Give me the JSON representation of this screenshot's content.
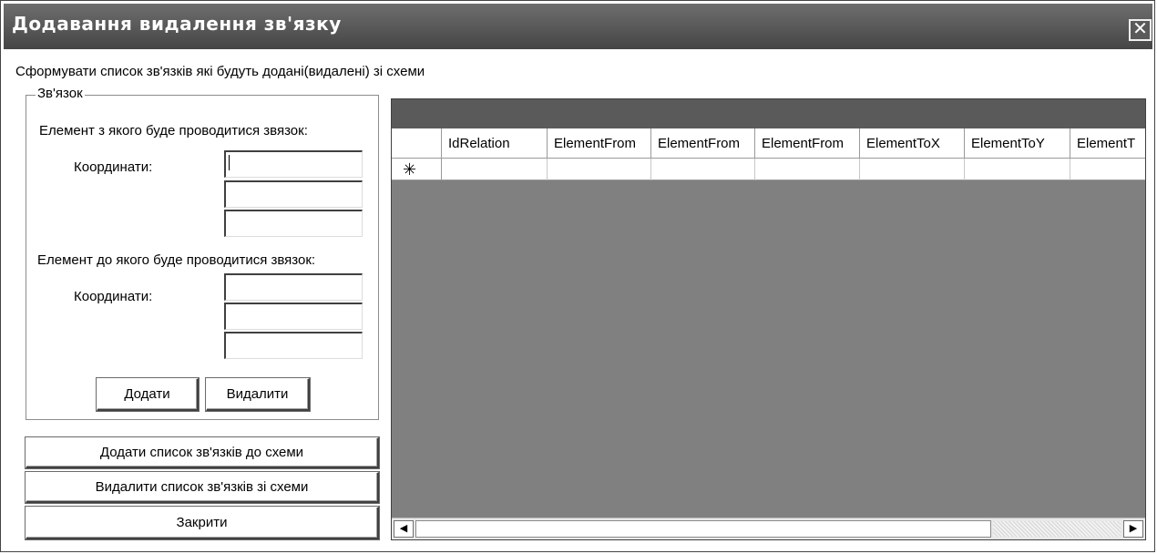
{
  "window": {
    "title": "Додавання видалення зв'язку",
    "close_glyph": "✕"
  },
  "instruction": "Сформувати список зв'язків які будуть додані(видалені) зі схеми",
  "group": {
    "title": "Зв'язок",
    "from_label": "Елемент з якого буде проводитися звязок:",
    "to_label": "Елемент до якого буде проводитися звязок:",
    "coords_label": "Координати:",
    "from_coords": [
      "",
      "",
      ""
    ],
    "to_coords": [
      "",
      "",
      ""
    ],
    "add_button": "Додати",
    "delete_button": "Видалити"
  },
  "actions": {
    "add_list": "Додати список зв'язків до схеми",
    "delete_list": "Видалити список зв'язків зі схеми",
    "close": "Закрити"
  },
  "grid": {
    "columns": [
      "IdRelation",
      "ElementFrom",
      "ElementFrom",
      "ElementFrom",
      "ElementToX",
      "ElementToY",
      "ElementT"
    ],
    "new_row_marker": "✳",
    "scroll_left": "◀",
    "scroll_right": "▶"
  },
  "colors": {
    "titlebar": "#4d4d4d",
    "grid_background": "#808080",
    "grid_caption": "#5a5a5a"
  }
}
